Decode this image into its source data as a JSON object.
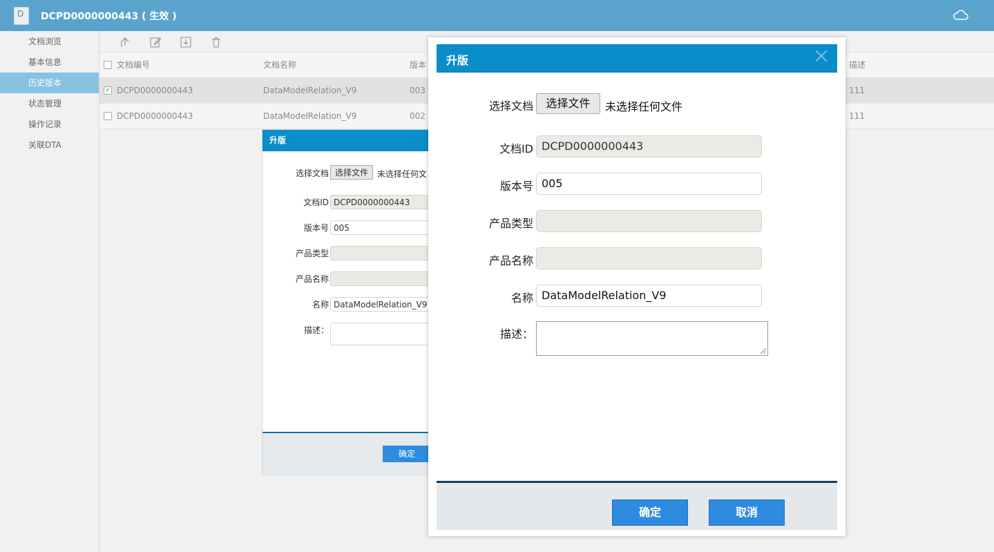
{
  "header": {
    "title": "DCPD0000000443 ( 生效 )",
    "doc_icon_letter": "D"
  },
  "sidebar": {
    "items": [
      {
        "label": "文档浏览"
      },
      {
        "label": "基本信息"
      },
      {
        "label": "历史版本"
      },
      {
        "label": "状态管理"
      },
      {
        "label": "操作记录"
      },
      {
        "label": "关联DTA"
      }
    ],
    "active_index": 2
  },
  "table": {
    "columns": [
      "文档编号",
      "文档名称",
      "版本",
      "描述"
    ],
    "rows": [
      {
        "checked": true,
        "check_mark": "✓",
        "doc_no": "DCPD0000000443",
        "doc_name": "DataModelRelation_V9",
        "version": "003",
        "desc": "111"
      },
      {
        "checked": false,
        "check_mark": "",
        "doc_no": "DCPD0000000443",
        "doc_name": "DataModelRelation_V9",
        "version": "002",
        "desc": "111"
      }
    ]
  },
  "dialog_bg": {
    "title": "升版",
    "choose_doc_label": "选择文档",
    "choose_file_btn": "选择文件",
    "no_file_text": "未选择任何文",
    "doc_id_label": "文档ID",
    "doc_id_value": "DCPD0000000443",
    "version_label": "版本号",
    "version_value": "005",
    "product_type_label": "产品类型",
    "product_name_label": "产品名称",
    "name_label": "名称",
    "name_value": "DataModelRelation_V9",
    "desc_label": "描述：",
    "ok_label": "确定"
  },
  "dialog": {
    "title": "升版",
    "choose_doc_label": "选择文档",
    "choose_file_btn": "选择文件",
    "no_file_text": "未选择任何文件",
    "doc_id_label": "文档ID",
    "doc_id_value": "DCPD0000000443",
    "version_label": "版本号",
    "version_value": "005",
    "product_type_label": "产品类型",
    "product_type_value": "",
    "product_name_label": "产品名称",
    "product_name_value": "",
    "name_label": "名称",
    "name_value": "DataModelRelation_V9",
    "desc_label": "描述：",
    "desc_value": "",
    "ok_label": "确定",
    "cancel_label": "取消"
  },
  "colors": {
    "header_bg": "#5aa3cc",
    "dialog_header": "#0b8dca",
    "button": "#2e8be0",
    "sidebar_active": "#87c2e3"
  }
}
